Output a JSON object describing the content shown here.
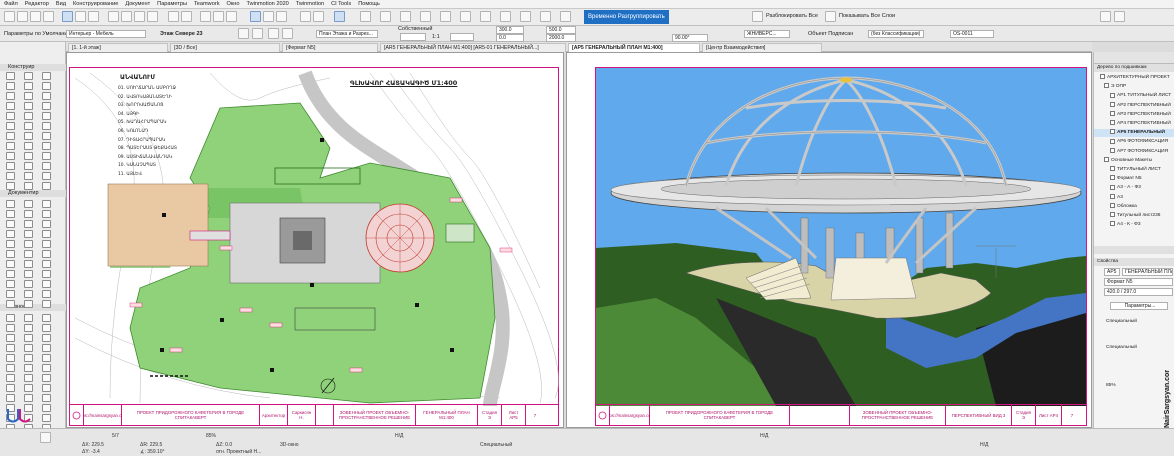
{
  "menu": [
    "Файл",
    "Редактор",
    "Вид",
    "Конструирование",
    "Документ",
    "Параметры",
    "Teamwork",
    "Окно",
    "Twinmotion 2020",
    "Twinmotion",
    "CI Tools",
    "Помощь"
  ],
  "toolbar": {
    "temp_regroup": "Временно Разгруппировать",
    "ungroup_all": "Разблокировать Все",
    "show_all_layers": "Показывать Все Слои"
  },
  "infobar": {
    "default_params": "Параметры по Умолчанию",
    "layer": "Интерьер - Мебель",
    "floor": "Этаж Севере 23",
    "plan_label": "План Этажа и Разрез...",
    "own": "Собственный",
    "val1": "300.0",
    "val2": "0.0",
    "scale": "1:1",
    "val3": "500.0",
    "val4": "2000.0",
    "angle": "90.00°",
    "pen": "ЖНИВЕРС...",
    "sign": "Объект Подписан",
    "classif": "(без Классификации)",
    "code": "OS-0011"
  },
  "tabs": [
    "[1. 1-й этаж]",
    "[3D / Все]",
    "[Фермат N5]",
    "[AR5 ГЕНЕРАЛЬНЫЙ ПЛАН М1:400] [AR5-01 ГЕНЕРАЛЬНЫЙ...]",
    "[AP5 ГЕНЕРАЛЬНЫЙ ПЛАН М1:400]",
    "[Центр Взаимодействия]"
  ],
  "toolbox": {
    "constructor_title": "Конструир",
    "documents_title": "Документир",
    "other_title": "Разное"
  },
  "left_sheet": {
    "legend_title": "ԱՆՎԱՆՈՒՄ",
    "legend": [
      "01. ՍՈՒՐՃԱՐԱՆ ԱՄԲՈՂՋ",
      "02. ԱՎՏՈԿԱՅԱՆԱՏԵՂԻ",
      "03. ԽՈՐՈՎԱԾԱՆՈՑ",
      "04. ԱՅԳԻ",
      "05. ԽԱՂԱՀՐԱՊԱՐԱԿ",
      "06. ԿՈԼՈՆԱԴ",
      "07. ԴԻՏԱՀՐԱՊԱՐԱԿ",
      "08. ՊԱՏԵՐԱՍՏ ԹԵՔԱՀԱՏ",
      "09. ԱՍՏԻՃԱՆԱՎԱՆԴԱԿ",
      "10. ԿԱՆԱՉԱՊԱՏ",
      "11. ԱՅԼԵՎ"
    ],
    "title": "ԳԼԽԱՎՈՐ ՀԱՏԱԿԱԳԻԾ Մ1:400",
    "tb_site": "https://mainsargsyan.com",
    "tb_project": "ПРОЕКТ ПРИДОРОЖНОГО КАФЕТЕРИЯ В ГОРОДЕ СПИТАКАВЕРТ",
    "tb_sig1": "Архитектор",
    "tb_sig2": "Конструктор",
    "tb_name1": "Саркисян Н.",
    "tb_name2": "Саркисян Н.",
    "tb_stage_title": "ЗОВЕННЫЙ ПРОЕКТ ОБЪЕМНО-ПРОСТРАНСТВЕННОЕ РЕШЕНИЕ",
    "tb_sheet_title": "ГЕНЕРАЛЬНЫЙ ПЛАН М1:400",
    "tb_stage": "Стадия Э",
    "tb_sheet": "Лист AP5",
    "tb_sheets": "7"
  },
  "right_sheet": {
    "tb_site": "https://mainsargsyan.com",
    "tb_project": "ПРОЕКТ ПРИДОРОЖНОГО КАФЕТЕРИЯ В ГОРОДЕ СПИТАКАВЕРТ",
    "tb_stage_title": "ЗОВЕННЫЙ ПРОЕКТ ОБЪЕМНО-ПРОСТРАНСТВЕННОЕ РЕШЕНИЕ",
    "tb_sheet_title": "ПЕРСПЕКТИВНЫЙ ВИД 3",
    "tb_stage": "Стадия Э",
    "tb_sheet": "Лист AP4",
    "tb_sheets": "7"
  },
  "navigator": {
    "title": "Дерево по подшивкам",
    "items": [
      {
        "label": "АРХИТЕКТУРНЫЙ ПРОЕКТ",
        "sel": false
      },
      {
        "label": "Э ОПР",
        "sel": false
      },
      {
        "label": "AP1 ТИТУЛЬНЫЙ ЛИСТ",
        "sel": false
      },
      {
        "label": "AP2 ПЕРСПЕКТИВНЫЙ",
        "sel": false
      },
      {
        "label": "AP3 ПЕРСПЕКТИВНЫЙ",
        "sel": false
      },
      {
        "label": "AP4 ПЕРСПЕКТИВНЫЙ",
        "sel": false
      },
      {
        "label": "AP5 ГЕНЕРАЛЬНЫЙ",
        "sel": true
      },
      {
        "label": "AP6 ФОТОФИКСАЦИЯ",
        "sel": false
      },
      {
        "label": "AP7 ФОТОФИКСАЦИЯ",
        "sel": false
      },
      {
        "label": "Основные Макеты",
        "sel": false
      },
      {
        "label": "ТИТУЛЬНЫЙ ЛИСТ",
        "sel": false
      },
      {
        "label": "Формат N5",
        "sel": false
      },
      {
        "label": "А3 - А - Ф3",
        "sel": false
      },
      {
        "label": "А3",
        "sel": false
      },
      {
        "label": "Обложка",
        "sel": false
      },
      {
        "label": "Титульный лист236",
        "sel": false
      },
      {
        "label": "А4 - К - Ф3",
        "sel": false
      }
    ],
    "props_title": "Свойства",
    "prop_id": "AP5",
    "prop_name": "ГЕНЕРАЛЬНЫЙ ПЛАН М1:4",
    "prop_format": "Формат N5",
    "prop_size": "420.0 / 297.0",
    "params_button": "Параметры...",
    "special": "Специальный",
    "special2": "Специальный",
    "zoom": "85%"
  },
  "status": {
    "page": "5/7",
    "dx": "ΔX: 229.5",
    "dy": "ΔY: -3.4",
    "ar": "ΔR: 229.5",
    "ang": "∡: 359.10°",
    "zoom": "85%",
    "dz": "ΔZ: 0.0",
    "ref": "отн. Проектный Н...",
    "view3d": "3D-окно",
    "nd": "Н/Д",
    "special": "Специальный",
    "watermark": "NairSargsyan.com"
  }
}
